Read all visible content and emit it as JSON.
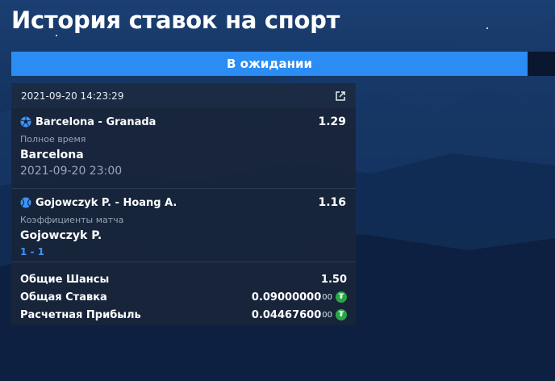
{
  "page": {
    "title": "История ставок на спорт"
  },
  "tabs": {
    "pending_label": "В ожидании"
  },
  "bet_slip": {
    "datetime": "2021-09-20 14:23:29",
    "share_icon": "external-link-icon",
    "bets": [
      {
        "sport_icon": "soccer-ball-icon",
        "match": "Barcelona - Granada",
        "odds": "1.29",
        "market": "Полное время",
        "pick": "Barcelona",
        "event_time": "2021-09-20 23:00"
      },
      {
        "sport_icon": "tennis-ball-icon",
        "match": "Gojowczyk P. - Hoang A.",
        "odds": "1.16",
        "market": "Коэффициенты матча",
        "pick": "Gojowczyk P.",
        "score": "1 - 1"
      }
    ],
    "summary": {
      "total_odds_label": "Общие Шансы",
      "total_odds_value": "1.50",
      "total_stake_label": "Общая Ставка",
      "total_stake_value": "0.09000000",
      "total_stake_suffix": "00",
      "payout_label": "Расчетная Прибыль",
      "payout_value": "0.04467600",
      "payout_suffix": "00",
      "currency_icon": "tether-coin-icon",
      "currency_symbol": "₮"
    }
  },
  "colors": {
    "accent": "#2b8cf3",
    "score_blue": "#3d93f5",
    "coin_green": "#28a745"
  }
}
